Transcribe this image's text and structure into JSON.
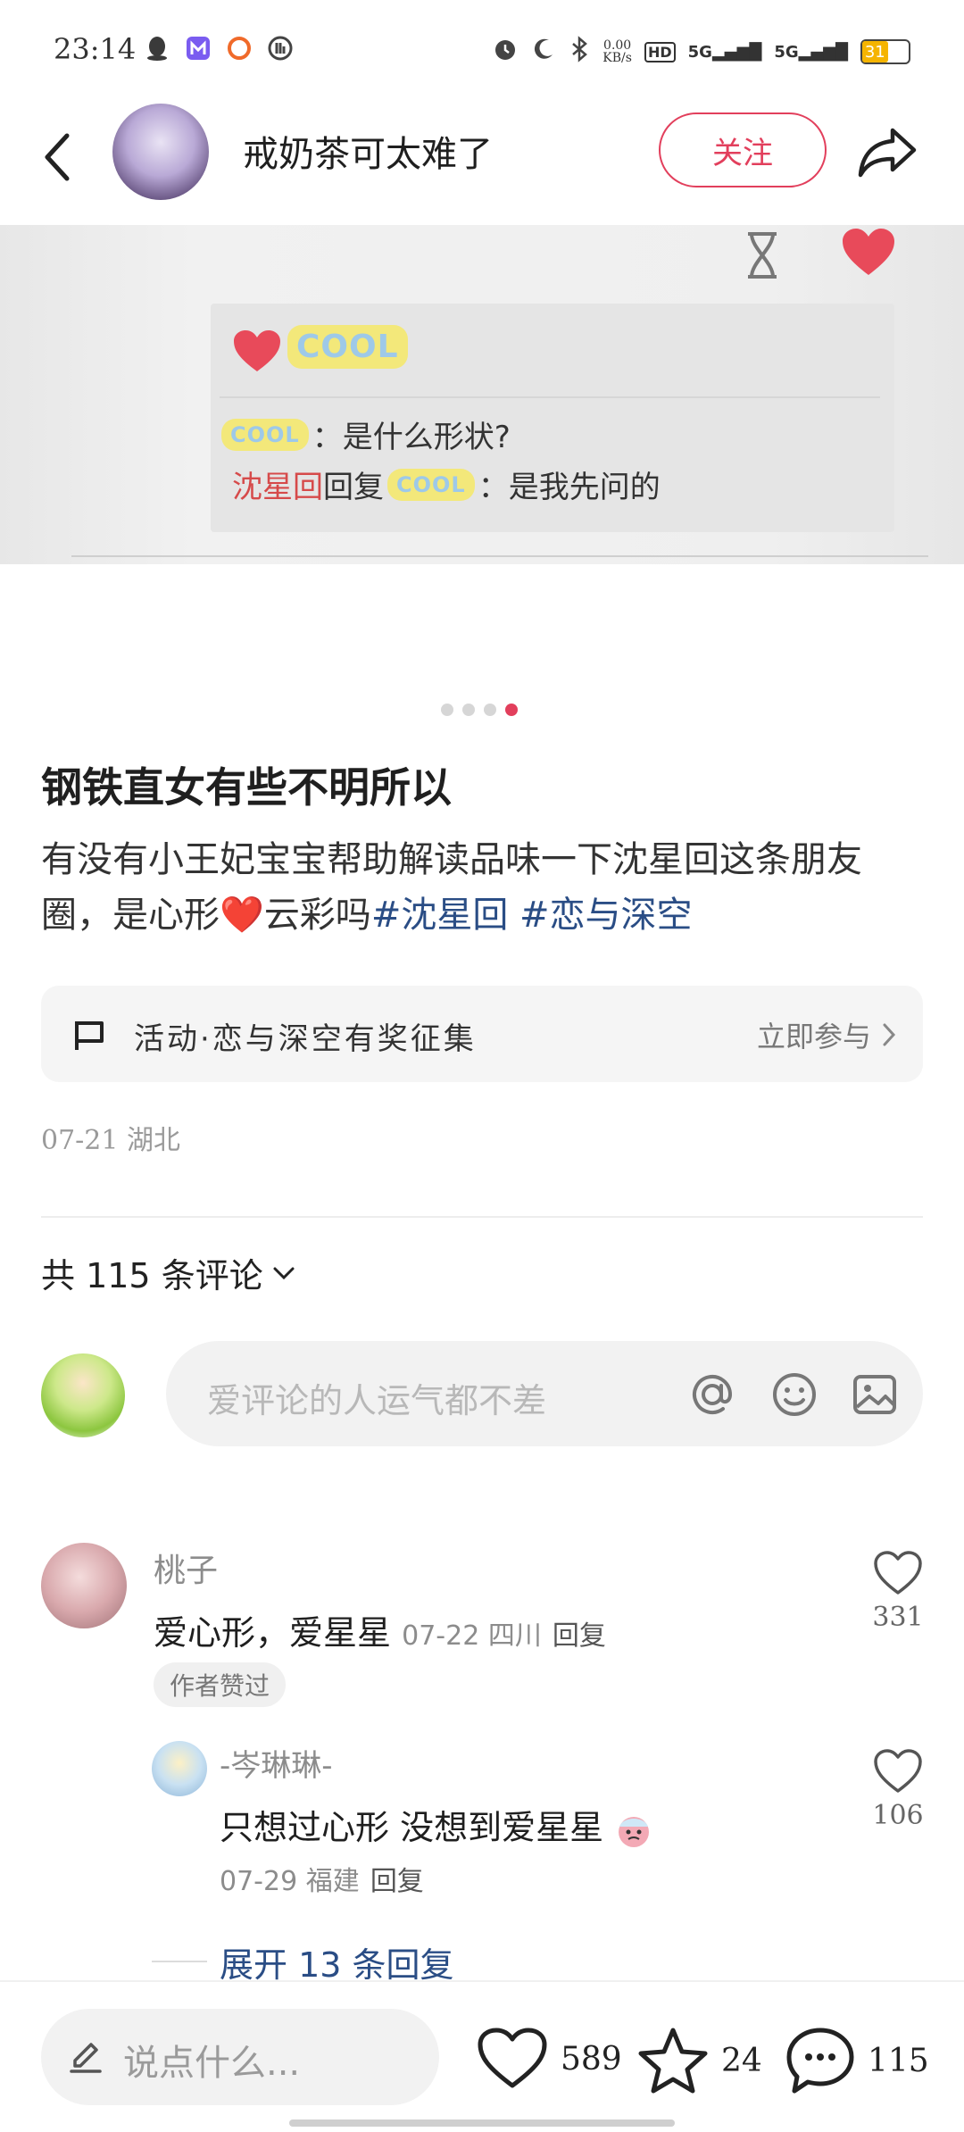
{
  "status_bar": {
    "time": "23:14",
    "network_speed": "0.00\nKB/s",
    "network_speed_top": "0.00",
    "network_speed_bottom": "KB/s",
    "hd_label": "HD",
    "sim1": "5G",
    "sim2": "5G",
    "battery": "31"
  },
  "header": {
    "author_name": "戒奶茶可太难了",
    "follow_label": "关注"
  },
  "image": {
    "cool_label": "COOL",
    "row1_suffix": "：是什么形状?",
    "row2_name": "沈星回",
    "row2_mid": "回复",
    "row2_suffix": "：是我先问的"
  },
  "pager": {
    "total": 4,
    "active_index": 3
  },
  "post": {
    "title": "钢铁直女有些不明所以",
    "body_part1": "有没有小王妃宝宝帮助解读品味一下沈星回这条朋友圈，是心形",
    "body_heart": "❤️",
    "body_part2": "云彩吗",
    "tag1": "#沈星回",
    "tag2": "#恋与深空",
    "date_location": "07-21 湖北"
  },
  "activity": {
    "label": "活动·恋与深空有奖征集",
    "cta": "立即参与"
  },
  "comments_section": {
    "count_label": "共 115 条评论",
    "input_placeholder": "爱评论的人运气都不差"
  },
  "comments": [
    {
      "author": "桃子",
      "text": "爱心形，爱星星",
      "meta": "07-22 四川",
      "reply_label": "回复",
      "likes": "331",
      "badge": "作者赞过"
    },
    {
      "author": "-岑琳琳-",
      "text": "只想过心形 没想到爱星星",
      "meta": "07-29 福建",
      "reply_label": "回复",
      "likes": "106"
    }
  ],
  "expand_replies": "展开 13 条回复",
  "bottom_bar": {
    "input_placeholder": "说点什么...",
    "likes": "589",
    "stars": "24",
    "comments": "115"
  },
  "colors": {
    "accent": "#e23f5c",
    "tag": "#2a4d85"
  }
}
